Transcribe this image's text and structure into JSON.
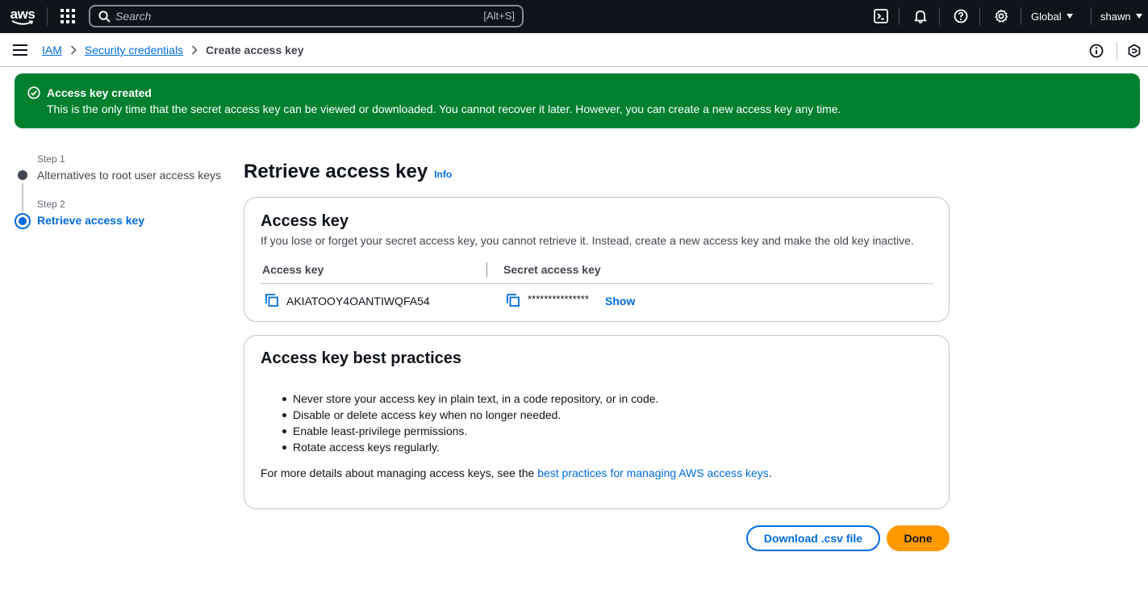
{
  "topnav": {
    "logo_text": "aws",
    "search_placeholder": "Search",
    "search_shortcut": "[Alt+S]",
    "region_label": "Global",
    "user_label": "shawn",
    "icons": [
      "services-grid-icon",
      "search-icon",
      "cloudshell-icon",
      "bell-icon",
      "help-icon",
      "gear-icon"
    ]
  },
  "breadcrumb": {
    "items": [
      "IAM",
      "Security credentials"
    ],
    "current": "Create access key"
  },
  "flash": {
    "title": "Access key created",
    "message": "This is the only time that the secret access key can be viewed or downloaded. You cannot recover it later. However, you can create a new access key any time.",
    "color": "#00802f"
  },
  "steps": [
    {
      "label": "Step 1",
      "title": "Alternatives to root user access keys",
      "state": "completed"
    },
    {
      "label": "Step 2",
      "title": "Retrieve access key",
      "state": "current"
    }
  ],
  "main": {
    "title": "Retrieve access key",
    "info_link": "Info",
    "access_key_card": {
      "title": "Access key",
      "description": "If you lose or forget your secret access key, you cannot retrieve it. Instead, create a new access key and make the old key inactive.",
      "col_access_key": "Access key",
      "col_secret_key": "Secret access key",
      "access_key_value": "AKIATOOY4OANTIWQFA54",
      "secret_key_masked": "***************",
      "show_label": "Show"
    },
    "best_practices_card": {
      "title": "Access key best practices",
      "items": [
        "Never store your access key in plain text, in a code repository, or in code.",
        "Disable or delete access key when no longer needed.",
        "Enable least-privilege permissions.",
        "Rotate access keys regularly."
      ],
      "more_prefix": "For more details about managing access keys, see the ",
      "more_link": "best practices for managing AWS access keys",
      "more_suffix": "."
    },
    "buttons": {
      "download": "Download .csv file",
      "done": "Done"
    }
  },
  "colors": {
    "accent": "#006ce0",
    "primary_button": "#ff9900",
    "nav_bg": "#0f141a"
  }
}
